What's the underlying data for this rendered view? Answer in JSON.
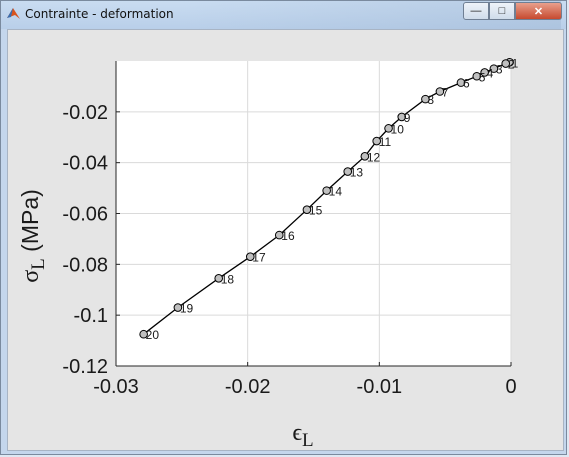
{
  "window": {
    "title": "Contrainte - deformation",
    "controls": {
      "minimize": "—",
      "maximize": "□",
      "close": "✕"
    }
  },
  "colors": {
    "figure_bg": "#e5e5e5",
    "axes_bg": "#ffffff",
    "line": "#000000",
    "marker_fill": "#c0c0c0"
  },
  "chart_data": {
    "type": "line",
    "xlabel_symbol": "ϵ",
    "xlabel_sub": "L",
    "ylabel_symbol": "σ",
    "ylabel_sub": "L",
    "ylabel_unit": " (MPa)",
    "xlim": [
      -0.03,
      0
    ],
    "ylim": [
      -0.12,
      0
    ],
    "xticks": [
      -0.03,
      -0.02,
      -0.01,
      0
    ],
    "xtick_labels": [
      "-0.03",
      "-0.02",
      "-0.01",
      "0"
    ],
    "yticks": [
      -0.02,
      -0.04,
      -0.06,
      -0.08,
      -0.1,
      -0.12
    ],
    "ytick_labels": [
      "-0.02",
      "-0.04",
      "-0.06",
      "-0.08",
      "-0.1",
      "-0.12"
    ],
    "grid": true,
    "marker": "circle",
    "points": [
      {
        "label": "1",
        "x": -0.0001,
        "y": -0.0005
      },
      {
        "label": "2",
        "x": -0.0004,
        "y": -0.001
      },
      {
        "label": "3",
        "x": -0.0013,
        "y": -0.003
      },
      {
        "label": "4",
        "x": -0.002,
        "y": -0.0045
      },
      {
        "label": "5",
        "x": -0.0026,
        "y": -0.006
      },
      {
        "label": "6",
        "x": -0.0038,
        "y": -0.0085
      },
      {
        "label": "7",
        "x": -0.0054,
        "y": -0.012
      },
      {
        "label": "8",
        "x": -0.0065,
        "y": -0.015
      },
      {
        "label": "9",
        "x": -0.0083,
        "y": -0.022
      },
      {
        "label": "10",
        "x": -0.0093,
        "y": -0.0265
      },
      {
        "label": "11",
        "x": -0.0102,
        "y": -0.0315
      },
      {
        "label": "12",
        "x": -0.0111,
        "y": -0.0375
      },
      {
        "label": "13",
        "x": -0.0124,
        "y": -0.0435
      },
      {
        "label": "14",
        "x": -0.014,
        "y": -0.051
      },
      {
        "label": "15",
        "x": -0.0155,
        "y": -0.0585
      },
      {
        "label": "16",
        "x": -0.0176,
        "y": -0.0685
      },
      {
        "label": "17",
        "x": -0.0198,
        "y": -0.077
      },
      {
        "label": "18",
        "x": -0.0222,
        "y": -0.0855
      },
      {
        "label": "19",
        "x": -0.0253,
        "y": -0.097
      },
      {
        "label": "20",
        "x": -0.0279,
        "y": -0.1075
      }
    ]
  }
}
